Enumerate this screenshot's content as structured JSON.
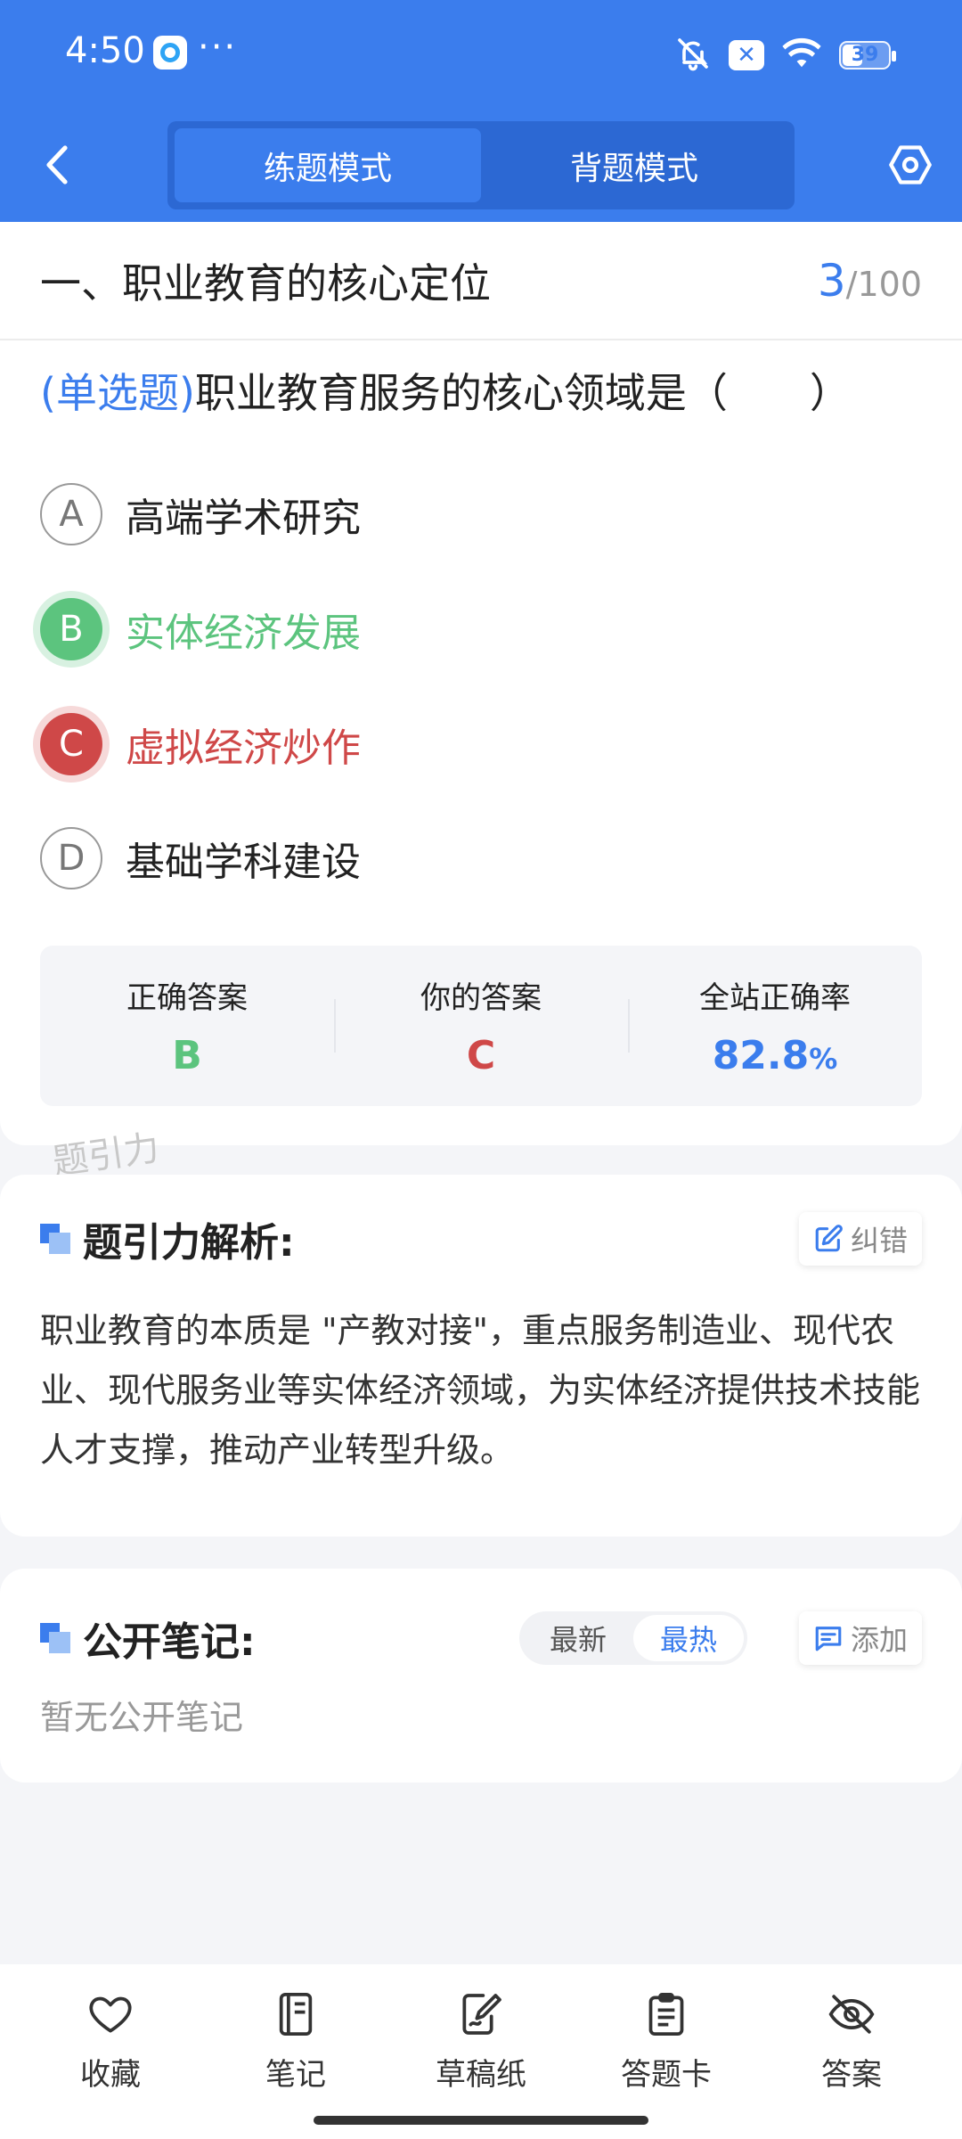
{
  "status_bar": {
    "time": "4:50",
    "dots": "···",
    "battery_level": "39",
    "icons": [
      "app-icon",
      "bell-off-icon",
      "x-app-icon",
      "wifi-icon",
      "battery-icon"
    ]
  },
  "header": {
    "tabs": [
      {
        "label": "练题模式",
        "active": true
      },
      {
        "label": "背题模式",
        "active": false
      }
    ]
  },
  "question_card": {
    "section_title": "一、职业教育的核心定位",
    "progress_current": "3",
    "progress_total": "/100",
    "question_type": "(单选题)",
    "question_text": "职业教育服务的核心领域是（　　）",
    "options": [
      {
        "letter": "A",
        "text": "高端学术研究",
        "state": "normal"
      },
      {
        "letter": "B",
        "text": "实体经济发展",
        "state": "correct"
      },
      {
        "letter": "C",
        "text": "虚拟经济炒作",
        "state": "wrong"
      },
      {
        "letter": "D",
        "text": "基础学科建设",
        "state": "normal"
      }
    ],
    "stats": {
      "correct_label": "正确答案",
      "correct_value": "B",
      "yours_label": "你的答案",
      "yours_value": "C",
      "rate_label": "全站正确率",
      "rate_value": "82.8",
      "rate_unit": "%"
    },
    "watermark": "题引力"
  },
  "analysis": {
    "title": "题引力解析:",
    "report_label": "纠错",
    "body": "职业教育的本质是 \"产教对接\"，重点服务制造业、现代农业、现代服务业等实体经济领域，为实体经济提供技术技能人才支撑，推动产业转型升级。"
  },
  "notes": {
    "title": "公开笔记:",
    "sort_newest": "最新",
    "sort_hottest": "最热",
    "add_label": "添加",
    "empty_text": "暂无公开笔记"
  },
  "bottom_nav": [
    {
      "label": "收藏",
      "icon": "heart-icon"
    },
    {
      "label": "笔记",
      "icon": "notebook-icon"
    },
    {
      "label": "草稿纸",
      "icon": "scratch-paper-icon"
    },
    {
      "label": "答题卡",
      "icon": "answer-sheet-icon"
    },
    {
      "label": "答案",
      "icon": "eye-off-icon"
    }
  ],
  "colors": {
    "primary": "#3b7ded",
    "correct": "#5cc47e",
    "wrong": "#cf4848"
  }
}
